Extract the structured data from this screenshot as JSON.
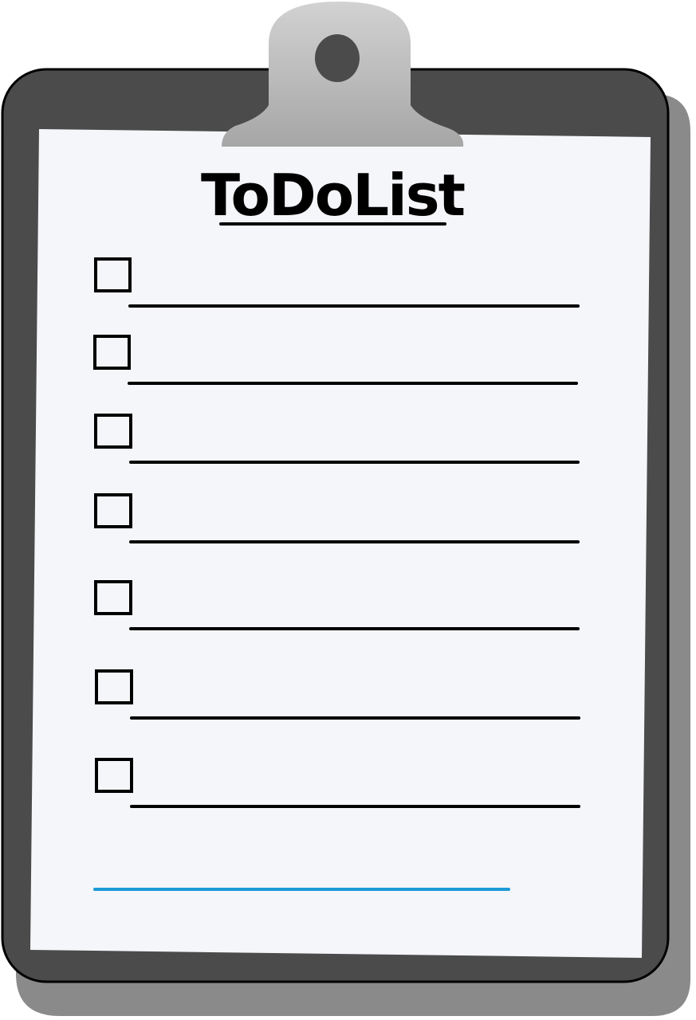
{
  "title": "ToDoList",
  "colors": {
    "shadow": "#8a8a8a",
    "board": "#4b4b4b",
    "outline": "#000000",
    "paper": "#f5f6fa",
    "clip_light": "#c8c8c8",
    "clip_dark": "#a7a7a7",
    "accent_line": "#1a9ad6"
  },
  "items": [
    {
      "checked": false
    },
    {
      "checked": false
    },
    {
      "checked": false
    },
    {
      "checked": false
    },
    {
      "checked": false
    },
    {
      "checked": false
    },
    {
      "checked": false
    }
  ]
}
